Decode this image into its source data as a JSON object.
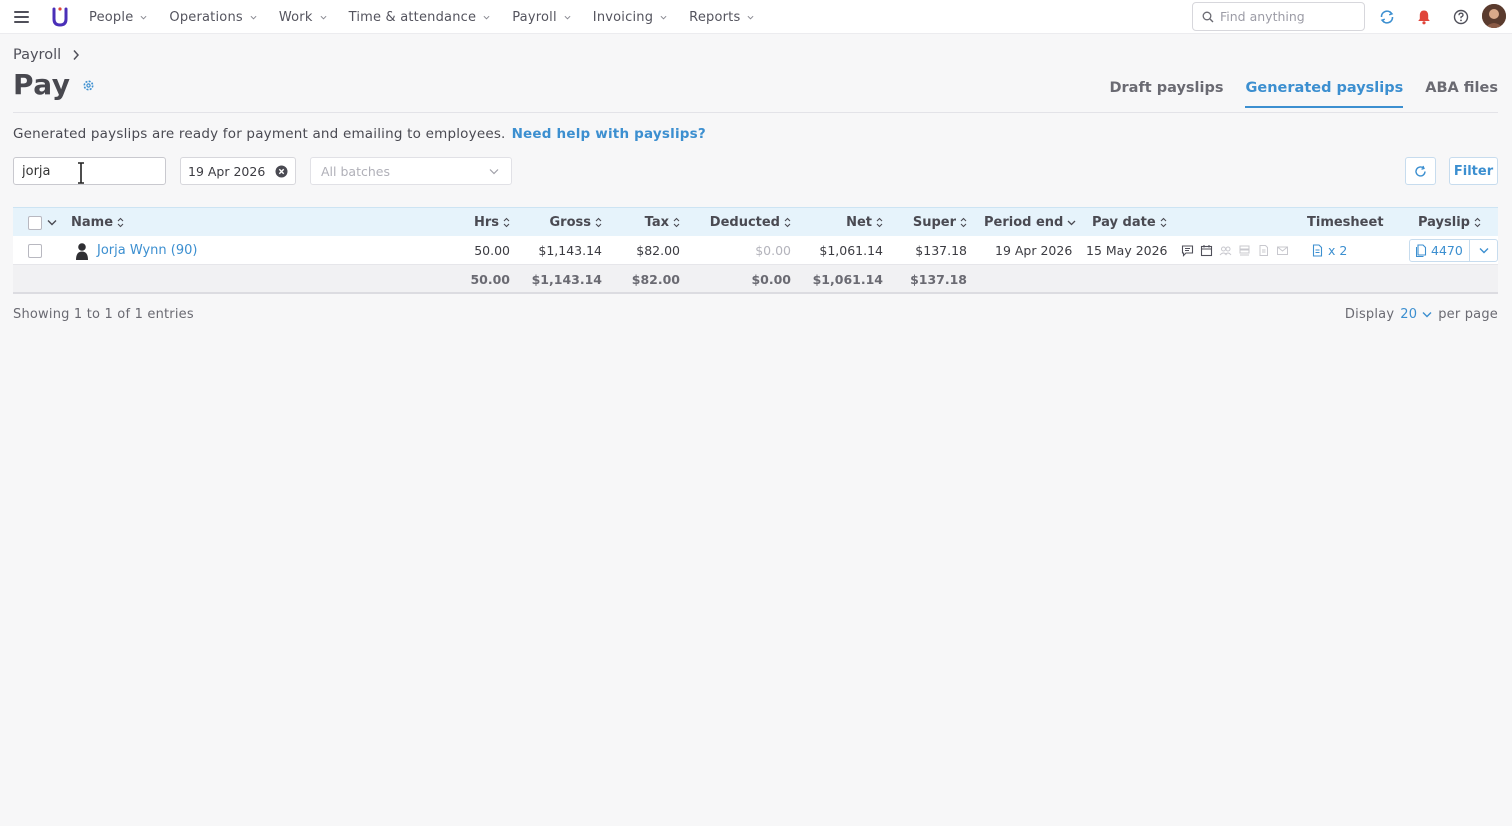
{
  "nav": {
    "items": [
      {
        "label": "People"
      },
      {
        "label": "Operations"
      },
      {
        "label": "Work"
      },
      {
        "label": "Time & attendance"
      },
      {
        "label": "Payroll"
      },
      {
        "label": "Invoicing"
      },
      {
        "label": "Reports"
      }
    ],
    "search_placeholder": "Find anything",
    "icons": [
      "menu-icon",
      "logo-icon",
      "search-icon",
      "sync-icon",
      "bell-icon",
      "help-icon",
      "avatar"
    ]
  },
  "header": {
    "breadcrumb": "Payroll",
    "title": "Pay",
    "tabs": [
      {
        "label": "Draft payslips",
        "active": false
      },
      {
        "label": "Generated payslips",
        "active": true
      },
      {
        "label": "ABA files",
        "active": false
      }
    ]
  },
  "info": {
    "text": "Generated payslips are ready for payment and emailing to employees.",
    "link": "Need help with payslips?"
  },
  "filters": {
    "name_value": "jorja",
    "date_value": "19 Apr 2026",
    "batch_placeholder": "All batches",
    "filter_label": "Filter"
  },
  "table": {
    "headers": {
      "name": "Name",
      "hrs": "Hrs",
      "gross": "Gross",
      "tax": "Tax",
      "deducted": "Deducted",
      "net": "Net",
      "super": "Super",
      "period_end": "Period end",
      "pay_date": "Pay date",
      "timesheet": "Timesheet",
      "payslip": "Payslip"
    },
    "rows": [
      {
        "name": "Jorja Wynn (90)",
        "hrs": "50.00",
        "gross": "$1,143.14",
        "tax": "$82.00",
        "deducted": "$0.00",
        "net": "$1,061.14",
        "super": "$137.18",
        "period_end": "19 Apr 2026",
        "pay_date": "15 May 2026",
        "timesheet": "x 2",
        "payslip": "4470"
      }
    ],
    "totals": {
      "hrs": "50.00",
      "gross": "$1,143.14",
      "tax": "$82.00",
      "deducted": "$0.00",
      "net": "$1,061.14",
      "super": "$137.18"
    }
  },
  "footer": {
    "showing": "Showing 1 to 1 of 1 entries",
    "display_label": "Display",
    "per_page_value": "20",
    "per_page_suffix": "per page"
  },
  "colors": {
    "accent": "#3c8fd0",
    "header_row": "#e6f3fb",
    "background": "#f7f7f8",
    "logo": "#4a2fb8",
    "bell": "#e0453a"
  }
}
